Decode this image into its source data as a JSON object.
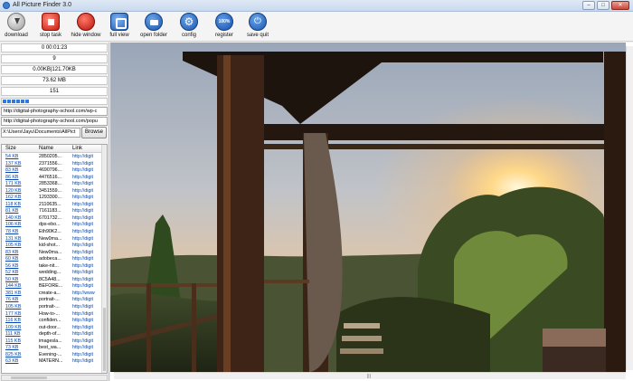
{
  "window": {
    "title": "All Picture Finder 3.0",
    "minimize": "–",
    "maximize": "□",
    "close": "✕"
  },
  "toolbar": {
    "buttons": [
      {
        "label": "download",
        "icon": "download-icon"
      },
      {
        "label": "stop task",
        "icon": "stop-icon"
      },
      {
        "label": "hide window",
        "icon": "hide-icon"
      },
      {
        "label": "full view",
        "icon": "full-view-icon"
      },
      {
        "label": "open folder",
        "icon": "folder-icon"
      },
      {
        "label": "config",
        "icon": "gear-icon"
      },
      {
        "label": "register",
        "icon": "register-icon"
      },
      {
        "label": "save quit",
        "icon": "power-icon"
      }
    ]
  },
  "stats": {
    "elapsed": "0 00:01:23",
    "count": "9",
    "transfer": "0.00KB|121.70KB",
    "total_size": "73.62 MB",
    "found": "151"
  },
  "progress_fraction": 0.25,
  "inputs": {
    "url1": "http://digital-photography-school.com/wp-c",
    "url2": "http://digital-photography-school.com/popu",
    "path": "X:\\Users\\Jayu\\Documents\\AllPict",
    "browse_label": "Browse"
  },
  "filelist": {
    "columns": [
      "Size",
      "Name",
      "Link"
    ],
    "rows": [
      {
        "size": "54 KB",
        "name": "2850205...",
        "link": "http://digit"
      },
      {
        "size": "137 KB",
        "name": "2371556...",
        "link": "http://digit"
      },
      {
        "size": "83 KB",
        "name": "4690796...",
        "link": "http://digit"
      },
      {
        "size": "86 KB",
        "name": "4476516...",
        "link": "http://digit"
      },
      {
        "size": "171 KB",
        "name": "2853368...",
        "link": "http://digit"
      },
      {
        "size": "120 KB",
        "name": "3451559...",
        "link": "http://digit"
      },
      {
        "size": "162 KB",
        "name": "1293300...",
        "link": "http://digit"
      },
      {
        "size": "118 KB",
        "name": "2110635...",
        "link": "http://digit"
      },
      {
        "size": "81 KB",
        "name": "7161183...",
        "link": "http://digit"
      },
      {
        "size": "140 KB",
        "name": "6701732...",
        "link": "http://digit"
      },
      {
        "size": "106 KB",
        "name": "dps-ebo...",
        "link": "http://digit"
      },
      {
        "size": "78 KB",
        "name": "Eth90K2...",
        "link": "http://digit"
      },
      {
        "size": "131 KB",
        "name": "New0ma...",
        "link": "http://digit"
      },
      {
        "size": "105 KB",
        "name": "kid-shot...",
        "link": "http://digit"
      },
      {
        "size": "83 KB",
        "name": "New0ma...",
        "link": "http://digit"
      },
      {
        "size": "60 KB",
        "name": "adobeca...",
        "link": "http://digit"
      },
      {
        "size": "56 KB",
        "name": "take-nit...",
        "link": "http://digit"
      },
      {
        "size": "52 KB",
        "name": "wedding...",
        "link": "http://digit"
      },
      {
        "size": "50 KB",
        "name": "8C5A48...",
        "link": "http://digit"
      },
      {
        "size": "144 KB",
        "name": "BEFORE...",
        "link": "http://digit"
      },
      {
        "size": "381 KB",
        "name": "create-a...",
        "link": "http://www"
      },
      {
        "size": "76 KB",
        "name": "portrait-...",
        "link": "http://digit"
      },
      {
        "size": "105 KB",
        "name": "portrait-...",
        "link": "http://digit"
      },
      {
        "size": "177 KB",
        "name": "How-to-...",
        "link": "http://digit"
      },
      {
        "size": "116 KB",
        "name": "confiden...",
        "link": "http://digit"
      },
      {
        "size": "109 KB",
        "name": "out-door...",
        "link": "http://digit"
      },
      {
        "size": "111 KB",
        "name": "depth-of...",
        "link": "http://digit"
      },
      {
        "size": "115 KB",
        "name": "imagesla...",
        "link": "http://digit"
      },
      {
        "size": "73 KB",
        "name": "best_wa...",
        "link": "http://digit"
      },
      {
        "size": "825 KB",
        "name": "Evening-...",
        "link": "http://digit"
      },
      {
        "size": "63 KB",
        "name": "MATERN...",
        "link": "http://digit"
      }
    ]
  },
  "viewer": {
    "scroll_grip": "|||"
  },
  "colors": {
    "accent_blue": "#1a55ad",
    "stop_red": "#c81e10",
    "progress_blue": "#2d7be0"
  }
}
